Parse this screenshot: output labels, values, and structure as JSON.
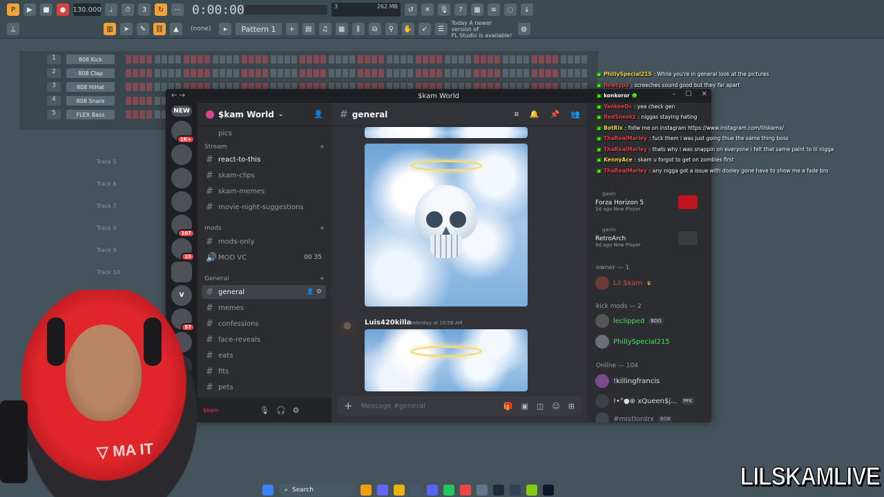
{
  "fl_studio": {
    "tempo": "130.000",
    "timecode": "0:00:00",
    "memory": "262 MB",
    "cpu_voices": "3",
    "cpu_extra": "0",
    "pattern": "Pattern 1",
    "none_select": "(none)",
    "update_note_line1": "Today  A newer version of",
    "update_note_line2": "FL Studio is available!",
    "channels": [
      {
        "num": "1",
        "name": "808 Kick"
      },
      {
        "num": "2",
        "name": "808 Clap"
      },
      {
        "num": "3",
        "name": "808 HiHat"
      },
      {
        "num": "4",
        "name": "808 Snare"
      },
      {
        "num": "5",
        "name": "FLEX Bass"
      }
    ],
    "tracks": [
      "Track 5",
      "Track 6",
      "Track 7",
      "Track 8",
      "Track 9",
      "Track 10"
    ]
  },
  "discord": {
    "window_title": "$kam World",
    "server_name": "$kam World",
    "server_list": [
      {
        "label": "NEW",
        "color": "#f23f43"
      },
      {
        "label": "",
        "color": "#2f9e44",
        "badge": "1K+"
      },
      {
        "label": "",
        "color": "#8a1c1c"
      },
      {
        "label": "",
        "color": "#c0392b"
      },
      {
        "label": "",
        "color": "#3b3b3b"
      },
      {
        "label": "",
        "color": "#2a2a2a",
        "badge": "107"
      },
      {
        "label": "",
        "color": "#1a1a1a",
        "badge": "15"
      },
      {
        "label": "",
        "color": "#7a1a1a"
      },
      {
        "label": "V",
        "color": "#4e5058"
      },
      {
        "label": "",
        "color": "#3a3a3a",
        "badge": "57"
      },
      {
        "label": "",
        "color": "#5b2f6e"
      }
    ],
    "channel_top_partial": "pics",
    "categories": {
      "stream": "Stream",
      "mods": "mods",
      "general": "General"
    },
    "stream_channels": [
      "react-to-this",
      "skam-clips",
      "skam-memes",
      "movie-night-suggestions"
    ],
    "mods_channels": [
      "mods-only",
      "MOD VC"
    ],
    "mod_vc_count_a": "00",
    "mod_vc_count_b": "35",
    "general_channels": [
      "general",
      "memes",
      "confessions",
      "face-reveals",
      "eats",
      "fits",
      "pets"
    ],
    "user_partial": "$kam",
    "current_channel": "general",
    "messages": [
      {
        "author": "Luis420killa",
        "time": "Yesterday at 10:58 AM"
      }
    ],
    "message_placeholder": "Message #general",
    "members": {
      "activities": [
        {
          "user": "gavin",
          "name": "Forza Horizon 5",
          "sub": "1d ago  New Player",
          "color": "#c1121f"
        },
        {
          "user": "gavin",
          "name": "RetroArch",
          "sub": "9d ago  New Player",
          "color": "#3a3c42"
        }
      ],
      "owner_header": "owner — 1",
      "owner": {
        "name": "Lil $kam",
        "color": "#f23f43"
      },
      "kick_mods_header": "kick mods — 2",
      "kick_mods": [
        {
          "name": "leclipped",
          "tag": "BDG",
          "color": "#43e55e"
        },
        {
          "name": "PhillySpecial215",
          "tag": "",
          "color": "#43e55e"
        }
      ],
      "online_header": "Online — 104",
      "online": [
        {
          "name": "!killingfrancis",
          "tag": "",
          "color": "#dbdee1"
        },
        {
          "name": "!•°●⊕ xQueen$j...",
          "tag": "PFK",
          "color": "#dbdee1"
        },
        {
          "name": "#mistlordrx",
          "tag": "BOB",
          "color": "#b5bac1"
        }
      ]
    }
  },
  "chat_overlay": [
    {
      "user": "PhillySpecial215",
      "user_color": "#f0d23a",
      "text": ": While you're in general look at the pictures"
    },
    {
      "user": "flowtyp3",
      "user_color": "#e04040",
      "text": ": screeches sound good but they far apart"
    },
    {
      "user": "konkoror",
      "user_color": "#ffffff",
      "text": ""
    },
    {
      "user": "YankeeDs",
      "user_color": "#e04040",
      "text": ": yea check gen"
    },
    {
      "user": "RedSneakz",
      "user_color": "#e04040",
      "text": ": niggas staying hating"
    },
    {
      "user": "BotRix",
      "user_color": "#f0d23a",
      "text": ": follw me on instagram https://www.instagram.com/lilskamx/"
    },
    {
      "user": "ThaRealMarley",
      "user_color": "#e04040",
      "text": ": fuck them i was just going thue the same thing boss"
    },
    {
      "user": "ThaRealMarley",
      "user_color": "#e04040",
      "text": ": thats why i was snappin on everyone i felt that same paint to lil nigga"
    },
    {
      "user": "KennyAce",
      "user_color": "#f0d23a",
      "text": ": skam u forgot to get on zombies first"
    },
    {
      "user": "ThaRealMarley",
      "user_color": "#e04040",
      "text": ": any nigga got a issue with dooley gone have to show me a fade bro"
    }
  ],
  "taskbar": {
    "search_label": "Search"
  },
  "watermark": "LILSKAMLIVE"
}
